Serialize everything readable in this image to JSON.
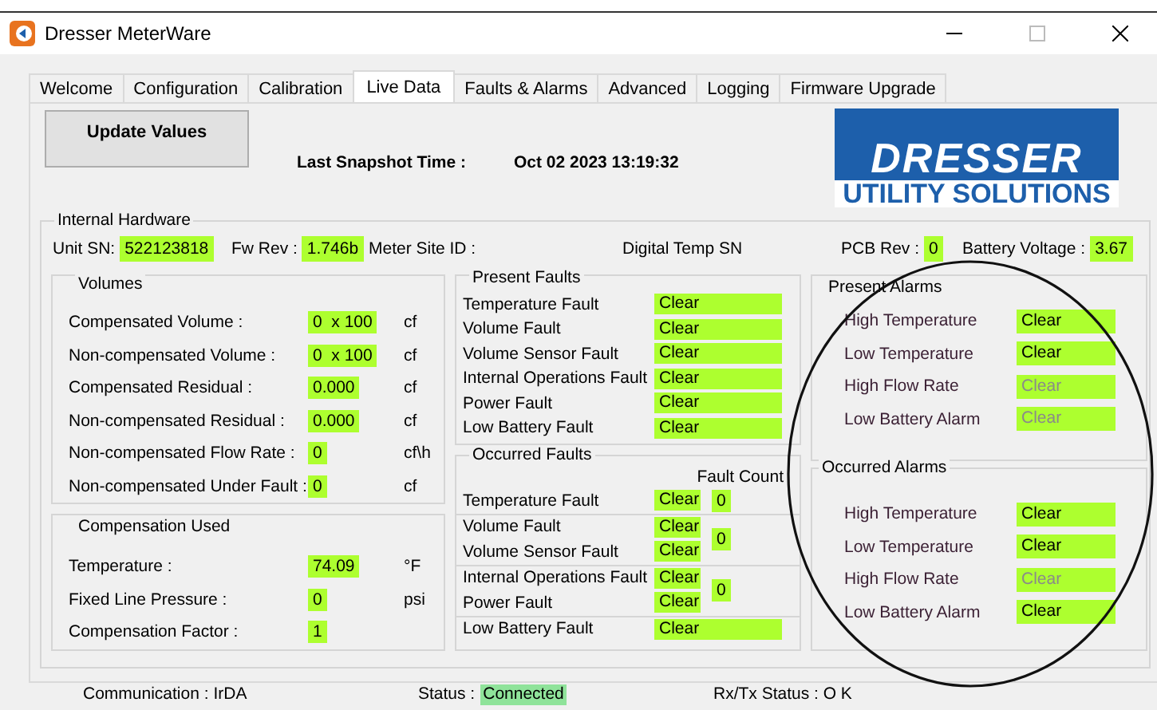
{
  "window": {
    "title": "Dresser MeterWare"
  },
  "tabs": [
    {
      "label": "Welcome",
      "selected": false
    },
    {
      "label": "Configuration",
      "selected": false
    },
    {
      "label": "Calibration",
      "selected": false
    },
    {
      "label": "Live Data",
      "selected": true
    },
    {
      "label": "Faults & Alarms",
      "selected": false
    },
    {
      "label": "Advanced",
      "selected": false
    },
    {
      "label": "Logging",
      "selected": false
    },
    {
      "label": "Firmware Upgrade",
      "selected": false
    }
  ],
  "update_button": "Update Values",
  "snapshot": {
    "label": "Last Snapshot Time :",
    "value": "Oct 02 2023 13:19:32"
  },
  "logo": {
    "brand": "DRESSER",
    "tagline": "UTILITY SOLUTIONS"
  },
  "internal_hardware": {
    "title": "Internal Hardware",
    "fields": [
      {
        "label": "Unit SN:",
        "value": "522123818"
      },
      {
        "label": "Fw Rev :",
        "value": "1.746b"
      },
      {
        "label": "Meter Site ID :"
      },
      {
        "label": "Digital Temp SN"
      },
      {
        "label": "PCB Rev :",
        "value": "0"
      },
      {
        "label": "Battery Voltage :",
        "value": "3.67"
      }
    ]
  },
  "volumes": {
    "title": "Volumes",
    "rows": [
      {
        "label": "Compensated Volume :",
        "value": "0  x 100",
        "unit": "cf"
      },
      {
        "label": "Non-compensated Volume :",
        "value": "0  x 100",
        "unit": "cf"
      },
      {
        "label": "Compensated Residual :",
        "value": "0.000",
        "unit": "cf"
      },
      {
        "label": "Non-compensated Residual :",
        "value": "0.000",
        "unit": "cf"
      },
      {
        "label": "Non-compensated Flow Rate :",
        "value": "0",
        "unit": "cf\\h"
      },
      {
        "label": "Non-compensated Under Fault :",
        "value": "0",
        "unit": "cf"
      }
    ]
  },
  "compensation": {
    "title": "Compensation Used",
    "rows": [
      {
        "label": "Temperature :",
        "value": "74.09",
        "unit": "°F"
      },
      {
        "label": "Fixed Line Pressure :",
        "value": "0",
        "unit": "psi"
      },
      {
        "label": "Compensation Factor :",
        "value": "1"
      }
    ]
  },
  "present_faults": {
    "title": "Present Faults",
    "rows": [
      {
        "label": "Temperature Fault",
        "value": "Clear"
      },
      {
        "label": "Volume Fault",
        "value": "Clear"
      },
      {
        "label": "Volume Sensor Fault",
        "value": "Clear"
      },
      {
        "label": "Internal Operations Fault",
        "value": "Clear"
      },
      {
        "label": "Power Fault",
        "value": "Clear"
      },
      {
        "label": "Low Battery Fault",
        "value": "Clear"
      }
    ]
  },
  "occurred_faults": {
    "title": "Occurred Faults",
    "count_heading": "Fault Count",
    "groups": [
      {
        "rows": [
          {
            "label": "Temperature Fault",
            "value": "Clear"
          }
        ],
        "count": "0"
      },
      {
        "rows": [
          {
            "label": "Volume Fault",
            "value": "Clear"
          },
          {
            "label": "Volume Sensor Fault",
            "value": "Clear"
          }
        ],
        "count": "0"
      },
      {
        "rows": [
          {
            "label": "Internal Operations Fault",
            "value": "Clear"
          },
          {
            "label": "Power Fault",
            "value": "Clear"
          }
        ],
        "count": "0"
      },
      {
        "rows": [
          {
            "label": "Low Battery Fault",
            "value": "Clear"
          }
        ]
      }
    ]
  },
  "present_alarms": {
    "title": "Present Alarms",
    "rows": [
      {
        "label": "High Temperature",
        "value": "Clear",
        "disabled": false
      },
      {
        "label": "Low Temperature",
        "value": "Clear",
        "disabled": false
      },
      {
        "label": "High Flow Rate",
        "value": "Clear",
        "disabled": true
      },
      {
        "label": "Low Battery Alarm",
        "value": "Clear",
        "disabled": true
      }
    ]
  },
  "occurred_alarms": {
    "title": "Occurred Alarms",
    "rows": [
      {
        "label": "High Temperature",
        "value": "Clear",
        "disabled": false
      },
      {
        "label": "Low Temperature",
        "value": "Clear",
        "disabled": false
      },
      {
        "label": "High Flow Rate",
        "value": "Clear",
        "disabled": true
      },
      {
        "label": "Low Battery Alarm",
        "value": "Clear",
        "disabled": false
      }
    ]
  },
  "status_bar": {
    "communication": "Communication : IrDA",
    "status_label": "Status :",
    "status_value": "Connected",
    "rxtx": "Rx/Tx Status : O K"
  }
}
